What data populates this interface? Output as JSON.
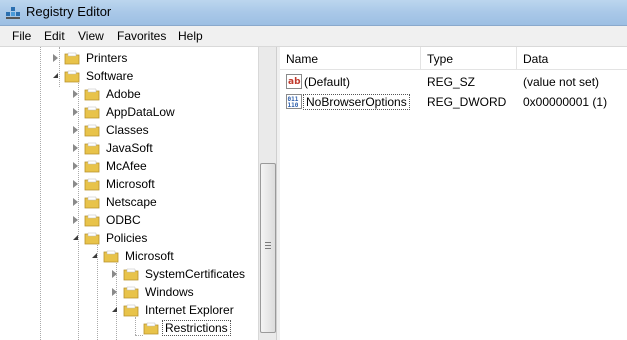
{
  "window": {
    "title": "Registry Editor"
  },
  "menu": [
    "File",
    "Edit",
    "View",
    "Favorites",
    "Help"
  ],
  "tree": [
    {
      "label": "Printers"
    },
    {
      "label": "Software"
    },
    {
      "label": "Adobe"
    },
    {
      "label": "AppDataLow"
    },
    {
      "label": "Classes"
    },
    {
      "label": "JavaSoft"
    },
    {
      "label": "McAfee"
    },
    {
      "label": "Microsoft"
    },
    {
      "label": "Netscape"
    },
    {
      "label": "ODBC"
    },
    {
      "label": "Policies"
    },
    {
      "label": "Microsoft"
    },
    {
      "label": "SystemCertificates"
    },
    {
      "label": "Windows"
    },
    {
      "label": "Internet Explorer"
    },
    {
      "label": "Restrictions"
    }
  ],
  "list": {
    "columns": [
      "Name",
      "Type",
      "Data"
    ],
    "rows": [
      {
        "name": "(Default)",
        "type": "REG_SZ",
        "data": "(value not set)",
        "icon": "string-value-icon"
      },
      {
        "name": "NoBrowserOptions",
        "type": "REG_DWORD",
        "data": "0x00000001 (1)",
        "icon": "binary-value-icon"
      }
    ]
  },
  "colors": {
    "folder": "#e8c34a",
    "titlebar": "#a9c8e8"
  }
}
